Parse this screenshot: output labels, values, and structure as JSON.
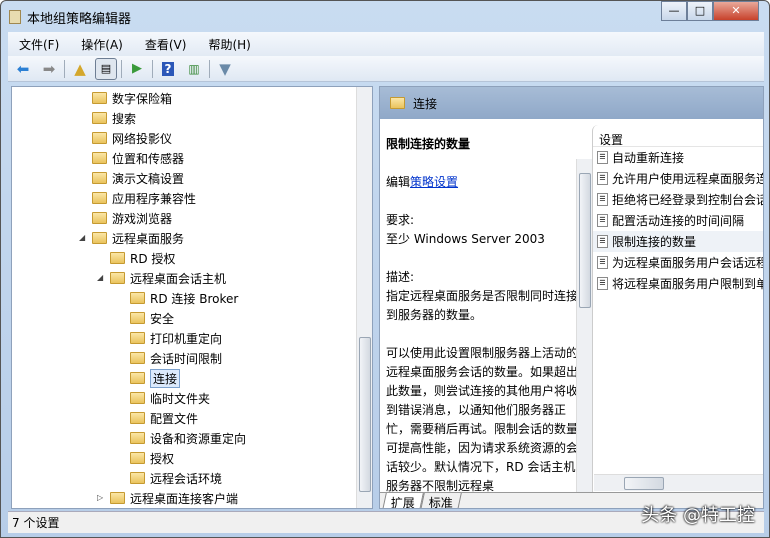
{
  "window": {
    "title": "本地组策略编辑器",
    "min": "—",
    "max": "□",
    "close": "✕"
  },
  "menu": [
    "文件(F)",
    "操作(A)",
    "查看(V)",
    "帮助(H)"
  ],
  "tree": [
    {
      "label": "数字保险箱",
      "level": 1
    },
    {
      "label": "搜索",
      "level": 1
    },
    {
      "label": "网络投影仪",
      "level": 1
    },
    {
      "label": "位置和传感器",
      "level": 1
    },
    {
      "label": "演示文稿设置",
      "level": 1
    },
    {
      "label": "应用程序兼容性",
      "level": 1
    },
    {
      "label": "游戏浏览器",
      "level": 1
    },
    {
      "label": "远程桌面服务",
      "level": 1,
      "expanded": true
    },
    {
      "label": "RD 授权",
      "level": 2
    },
    {
      "label": "远程桌面会话主机",
      "level": 2,
      "expanded": true
    },
    {
      "label": "RD 连接 Broker",
      "level": 3
    },
    {
      "label": "安全",
      "level": 3
    },
    {
      "label": "打印机重定向",
      "level": 3
    },
    {
      "label": "会话时间限制",
      "level": 3
    },
    {
      "label": "连接",
      "level": 3,
      "selected": true
    },
    {
      "label": "临时文件夹",
      "level": 3
    },
    {
      "label": "配置文件",
      "level": 3
    },
    {
      "label": "设备和资源重定向",
      "level": 3
    },
    {
      "label": "授权",
      "level": 3
    },
    {
      "label": "远程会话环境",
      "level": 3
    },
    {
      "label": "远程桌面连接客户端",
      "level": 2,
      "collapsed": true
    }
  ],
  "right": {
    "header": "连接",
    "desc_title": "限制连接的数量",
    "edit_prefix": "编辑",
    "edit_link": "策略设置",
    "req_label": "要求:",
    "req_value": "至少 Windows Server 2003",
    "desc_label": "描述:",
    "desc_text": "指定远程桌面服务是否限制同时连接到服务器的数量。",
    "desc_more": "可以使用此设置限制服务器上活动的远程桌面服务会话的数量。如果超出此数量，则尝试连接的其他用户将收到错误消息，以通知他们服务器正忙，需要稍后再试。限制会话的数量可提高性能，因为请求系统资源的会话较少。默认情况下，RD 会话主机服务器不限制远程桌",
    "settings_header": "设置",
    "settings": [
      "自动重新连接",
      "允许用户使用远程桌面服务连接",
      "拒绝将已经登录到控制台会话",
      "配置活动连接的时间间隔",
      "限制连接的数量",
      "为远程桌面服务用户会话远程",
      "将远程桌面服务用户限制到单"
    ],
    "tabs": [
      "扩展",
      "标准"
    ]
  },
  "status": "7 个设置",
  "watermark": "头条 @特工控"
}
